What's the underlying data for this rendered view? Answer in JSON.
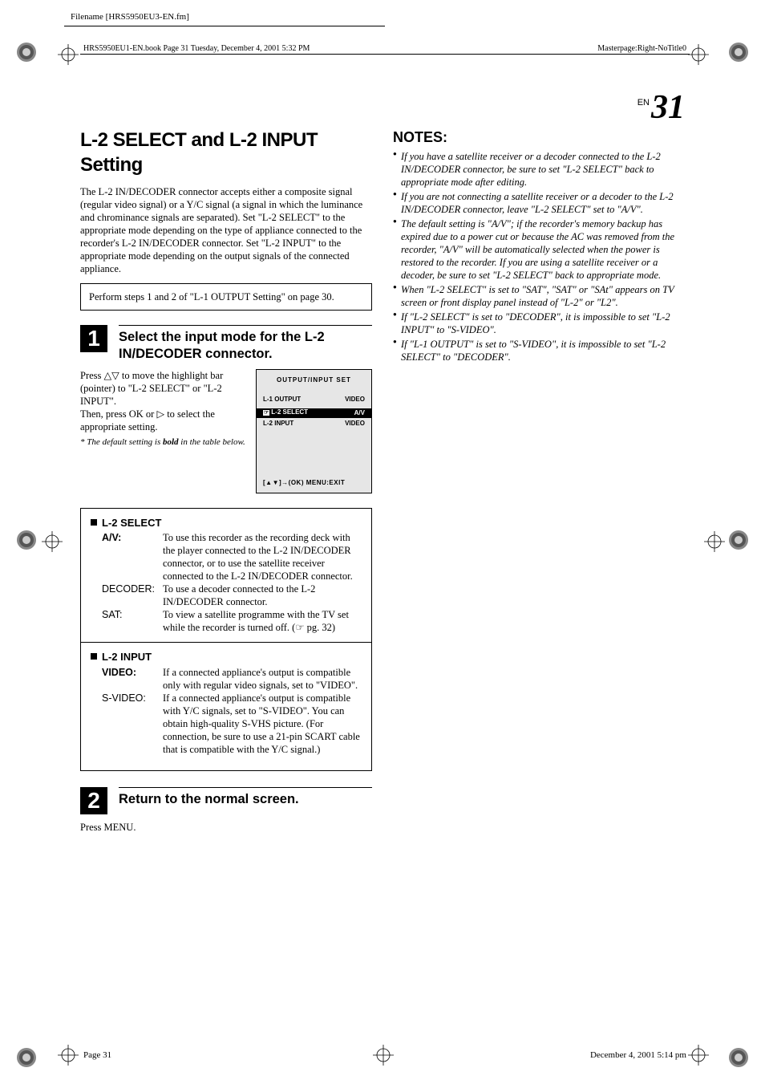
{
  "meta": {
    "filename": "Filename [HRS5950EU3-EN.fm]",
    "book_header": "HRS5950EU1-EN.book  Page 31  Tuesday, December 4, 2001  5:32 PM",
    "masterpage": "Masterpage:Right-NoTitle0",
    "page_label_prefix": "EN",
    "page_label_num": "31",
    "footer_left": "Page 31",
    "footer_right": "December 4, 2001  5:14 pm"
  },
  "title": "L-2 SELECT and L-2 INPUT Setting",
  "intro": "The L-2 IN/DECODER connector accepts either a composite signal (regular video signal) or a Y/C signal (a signal in which the luminance and chrominance signals are separated). Set \"L-2 SELECT\" to the appropriate mode depending on the type of appliance connected to the recorder's L-2 IN/DECODER connector. Set \"L-2 INPUT\" to the appropriate mode depending on the output signals of the connected appliance.",
  "perform": "Perform steps 1 and 2 of \"L-1 OUTPUT Setting\" on page 30.",
  "step1": {
    "num": "1",
    "title": "Select the input mode for the L-2 IN/DECODER connector.",
    "body_a": "Press △▽ to move the highlight bar (pointer) to \"L-2 SELECT\" or \"L-2 INPUT\".",
    "body_b": "Then, press OK or ▷ to select the appropriate setting.",
    "footnote_pre": "*  The default setting is ",
    "footnote_bold": "bold",
    "footnote_post": " in the table below.",
    "osd": {
      "title": "OUTPUT/INPUT SET",
      "row1_l": "L-1 OUTPUT",
      "row1_r": "VIDEO",
      "sel_l": "L-2 SELECT",
      "sel_r": "A/V",
      "row3_l": "L-2 INPUT",
      "row3_r": "VIDEO",
      "foot": "[▲▼]→(OK)  MENU:EXIT"
    }
  },
  "options": {
    "l2select": {
      "head": "L-2 SELECT",
      "av_label": "A/V:",
      "av_desc": "To use this recorder as the recording deck with the player connected to the L-2 IN/DECODER connector, or to use the satellite receiver connected to the L-2 IN/DECODER connector.",
      "dec_label": "DECODER:",
      "dec_desc": "To use a decoder connected to the L-2 IN/DECODER connector.",
      "sat_label": "SAT:",
      "sat_desc": "To view a satellite programme with the TV set while the recorder is turned off. (☞ pg. 32)"
    },
    "l2input": {
      "head": "L-2 INPUT",
      "video_label": "VIDEO:",
      "video_desc": "If a connected appliance's output is compatible only with regular video signals, set to \"VIDEO\".",
      "svideo_label": "S-VIDEO:",
      "svideo_desc": "If a connected appliance's output is compatible with Y/C signals, set to \"S-VIDEO\". You can obtain high-quality S-VHS picture. (For connection, be sure to use a 21-pin SCART cable that is compatible with the Y/C signal.)"
    }
  },
  "step2": {
    "num": "2",
    "title": "Return to the normal screen.",
    "body": "Press MENU."
  },
  "notes": {
    "head": "NOTES:",
    "items": [
      "If you have a satellite receiver or a decoder connected to the L-2 IN/DECODER connector, be sure to set \"L-2 SELECT\" back to appropriate mode after editing.",
      "If you are not connecting a satellite receiver or a decoder to the L-2 IN/DECODER connector, leave \"L-2 SELECT\" set to \"A/V\".",
      "The default setting is \"A/V\"; if the recorder's memory backup has expired due to a power cut or because the AC was removed from the recorder, \"A/V\" will be automatically selected when the power is restored to the recorder. If you are using a satellite receiver or a decoder, be sure to set \"L-2 SELECT\" back to appropriate mode.",
      "When \"L-2 SELECT\" is set to \"SAT\", \"SAT\" or \"SAt\" appears on TV screen or front display panel instead of \"L-2\" or \"L2\".",
      "If \"L-2 SELECT\" is set to \"DECODER\", it is impossible to set \"L-2 INPUT\" to \"S-VIDEO\".",
      "If \"L-1 OUTPUT\" is set to \"S-VIDEO\", it is impossible to set \"L-2 SELECT\" to \"DECODER\"."
    ]
  }
}
